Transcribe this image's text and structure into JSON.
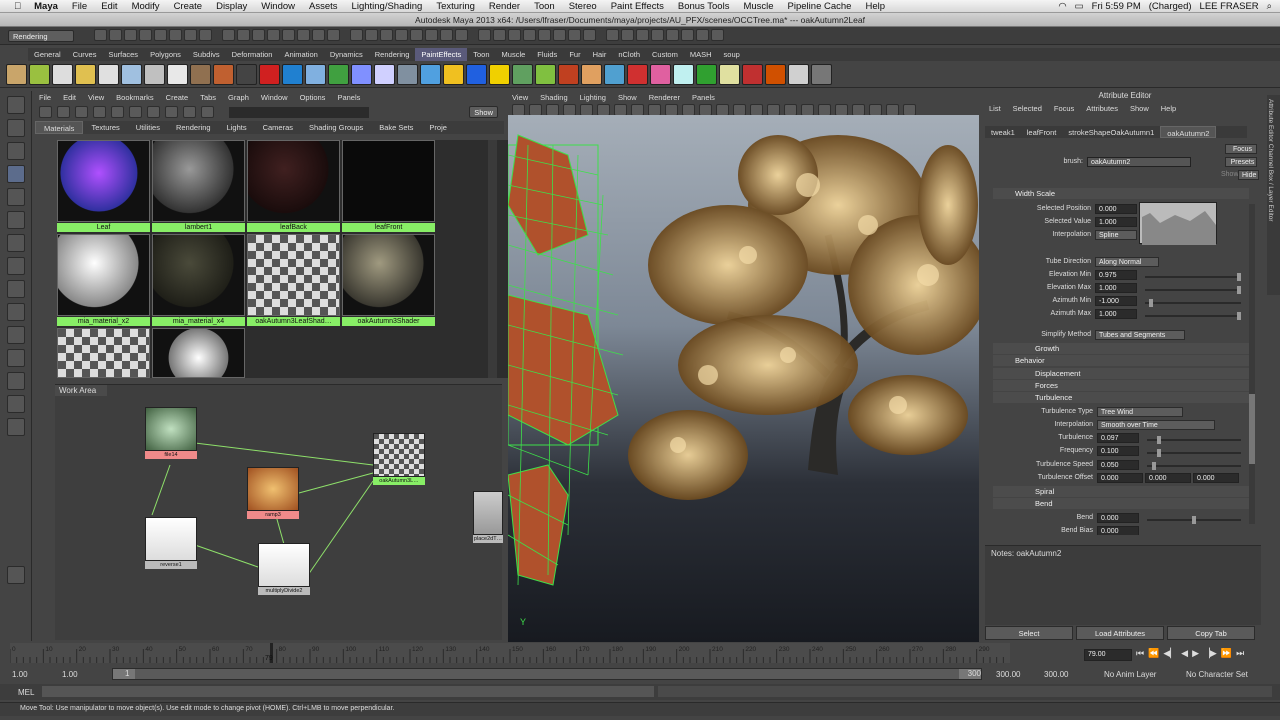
{
  "macbar": {
    "items": [
      "Maya",
      "File",
      "Edit",
      "Modify",
      "Create",
      "Display",
      "Window",
      "Assets",
      "Lighting/Shading",
      "Texturing",
      "Render",
      "Toon",
      "Stereo",
      "Paint Effects",
      "Bonus Tools",
      "Muscle",
      "Pipeline Cache",
      "Help"
    ],
    "clock": "Fri 5:59 PM",
    "battery": "(Charged)",
    "user": "LEE FRASER"
  },
  "title": "Autodesk Maya 2013 x64: /Users/lfraser/Documents/maya/projects/AU_PFX/scenes/OCCTree.ma*   ---   oakAutumn2Leaf",
  "status": {
    "menu_set": "Rendering"
  },
  "shelf": {
    "tabs": [
      "General",
      "Curves",
      "Surfaces",
      "Polygons",
      "Subdivs",
      "Deformation",
      "Animation",
      "Dynamics",
      "Rendering",
      "PaintEffects",
      "Toon",
      "Muscle",
      "Fluids",
      "Fur",
      "Hair",
      "nCloth",
      "Custom",
      "MASH",
      "soup"
    ],
    "active": "PaintEffects",
    "icons": [
      "#c9a56a",
      "#9ac040",
      "#ddd",
      "#e0c050",
      "#e0e0e0",
      "#a0c0e0",
      "#c0c0c0",
      "#e8e8e8",
      "#907050",
      "#c06030",
      "#444",
      "#d02020",
      "#2080d0",
      "#80b0e0",
      "#40a040",
      "#8090ff",
      "#d0d0ff",
      "#8090a0",
      "#50a0e0",
      "#f0c020",
      "#2060e0",
      "#f0d000",
      "#60a060",
      "#80c040",
      "#c04020",
      "#e0a060",
      "#50a0d0",
      "#d03030",
      "#e060a0",
      "#c0f0f0",
      "#30a030",
      "#e0e0a0",
      "#c03030",
      "#d05000",
      "#d0d0d0",
      "#777"
    ]
  },
  "hypershade": {
    "menus": [
      "File",
      "Edit",
      "View",
      "Bookmarks",
      "Create",
      "Tabs",
      "Graph",
      "Window",
      "Options",
      "Panels"
    ],
    "show_button": "Show",
    "tabs": [
      "Materials",
      "Textures",
      "Utilities",
      "Rendering",
      "Lights",
      "Cameras",
      "Shading Groups",
      "Bake Sets",
      "Proje"
    ],
    "swatches": [
      {
        "label": "Leaf",
        "sel": true
      },
      {
        "label": "lambert1",
        "sel": true
      },
      {
        "label": "leafBack",
        "sel": true
      },
      {
        "label": "leafFront",
        "sel": true
      },
      {
        "label": "mia_material_x2",
        "sel": true
      },
      {
        "label": "mia_material_x4",
        "sel": true
      },
      {
        "label": "oakAutumn3LeafShad…",
        "sel": true
      },
      {
        "label": "oakAutumn3Shader",
        "sel": true
      },
      {
        "label": "",
        "sel": false
      },
      {
        "label": "",
        "sel": false
      }
    ],
    "work_area_label": "Work Area",
    "nodes": [
      {
        "label": "file14",
        "color": "#f08a8a"
      },
      {
        "label": "ramp3",
        "color": "#f08a8a"
      },
      {
        "label": "reverse1",
        "color": "#bbbbbb"
      },
      {
        "label": "multiplyDivide2",
        "color": "#bbbbbb"
      },
      {
        "label": "oakAutumn3L…",
        "color": "#88ee66"
      },
      {
        "label": "place2dT…",
        "color": "#bbbbbb"
      }
    ]
  },
  "viewport": {
    "menus": [
      "View",
      "Shading",
      "Lighting",
      "Show",
      "Renderer",
      "Panels"
    ],
    "camera_label": "",
    "axis": "Y"
  },
  "attribute_editor": {
    "title": "Attribute Editor",
    "menus": [
      "List",
      "Selected",
      "Focus",
      "Attributes",
      "Show",
      "Help"
    ],
    "tabs": [
      "tweak1",
      "leafFront",
      "strokeShapeOakAutumn1",
      "oakAutumn2"
    ],
    "active_tab": "oakAutumn2",
    "brush_label": "brush:",
    "brush_value": "oakAutumn2",
    "focus_btn": "Focus",
    "presets_btn": "Presets",
    "show_btn": "Show",
    "hide_btn": "Hide",
    "width_scale": "Width Scale",
    "selected_position_label": "Selected Position",
    "selected_position": "0.000",
    "selected_value_label": "Selected Value",
    "selected_value": "1.000",
    "interpolation_label": "Interpolation",
    "interpolation": "Spline",
    "tube_direction_label": "Tube Direction",
    "tube_direction": "Along Normal",
    "elev_min_label": "Elevation Min",
    "elev_min": "0.975",
    "elev_max_label": "Elevation Max",
    "elev_max": "1.000",
    "az_min_label": "Azimuth Min",
    "az_min": "-1.000",
    "az_max_label": "Azimuth Max",
    "az_max": "1.000",
    "simplify_label": "Simplify Method",
    "simplify": "Tubes and Segments",
    "sec_growth": "Growth",
    "sec_behavior": "Behavior",
    "sec_displacement": "Displacement",
    "sec_forces": "Forces",
    "sec_turbulence": "Turbulence",
    "turb_type_label": "Turbulence Type",
    "turb_type": "Tree Wind",
    "turb_interp_label": "Interpolation",
    "turb_interp": "Smooth over Time",
    "turbulence_label": "Turbulence",
    "turbulence": "0.097",
    "frequency_label": "Frequency",
    "frequency": "0.100",
    "turb_speed_label": "Turbulence Speed",
    "turb_speed": "0.050",
    "turb_offset_label": "Turbulence Offset",
    "turb_offset": [
      "0.000",
      "0.000",
      "0.000"
    ],
    "sec_spiral": "Spiral",
    "sec_bend": "Bend",
    "bend_label": "Bend",
    "bend": "0.000",
    "bend_bias_label": "Bend Bias",
    "bend_bias": "0.000",
    "notes": "Notes:  oakAutumn2",
    "select_btn": "Select",
    "load_btn": "Load Attributes",
    "copy_btn": "Copy Tab"
  },
  "timeline": {
    "ticks": [
      "0",
      "10",
      "20",
      "30",
      "40",
      "50",
      "60",
      "70",
      "80",
      "90",
      "100",
      "110",
      "120",
      "130",
      "140",
      "150",
      "160",
      "170",
      "180",
      "190",
      "200",
      "210",
      "220",
      "230",
      "240",
      "250",
      "260",
      "270",
      "280",
      "290"
    ],
    "current_frame": "79",
    "current_field": "79.00",
    "progress": 0.26
  },
  "range": {
    "start": "1.00",
    "start2": "1.00",
    "slider_start": "1",
    "slider_end": "300",
    "end": "300.00",
    "end2": "300.00",
    "anim_layer": "No Anim Layer",
    "char_set": "No Character Set"
  },
  "cmdline": {
    "label": "MEL"
  },
  "help": "Move Tool: Use manipulator to move object(s). Use edit mode to change pivot (HOME). Ctrl+LMB to move perpendicular.",
  "side_tabs": "Attribute Editor   Channel Box / Layer Editor"
}
